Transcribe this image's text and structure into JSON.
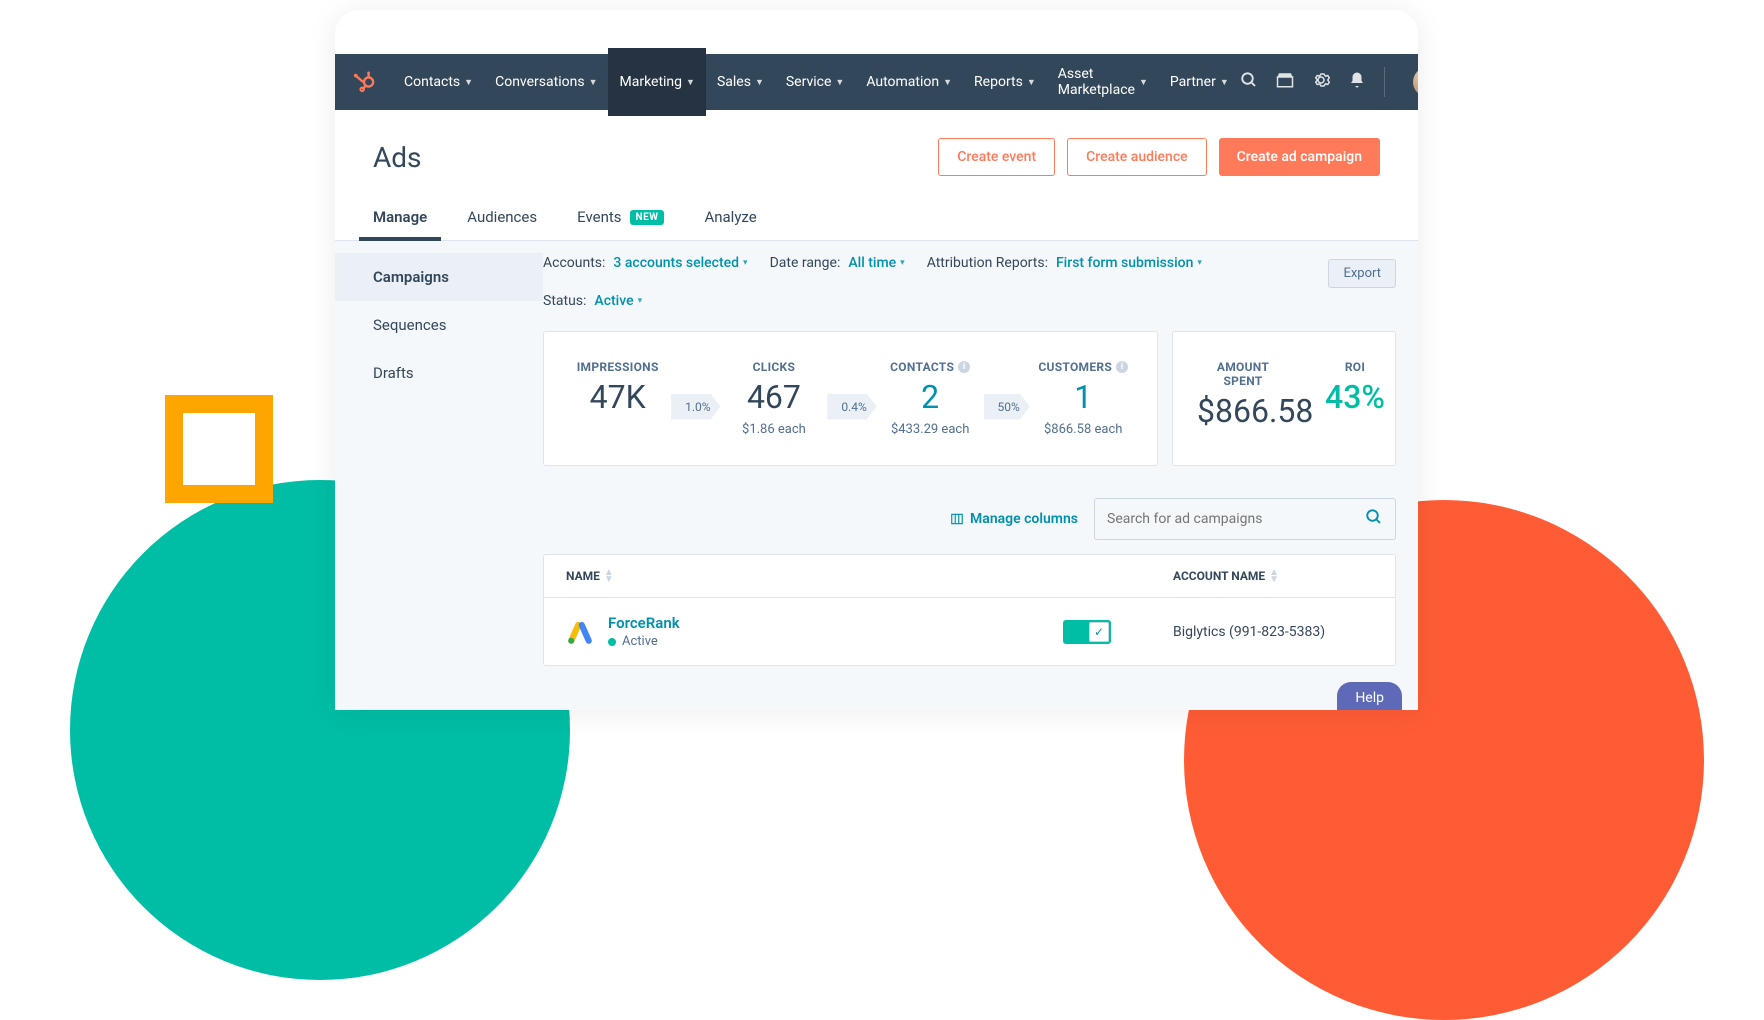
{
  "nav": {
    "items": [
      "Contacts",
      "Conversations",
      "Marketing",
      "Sales",
      "Service",
      "Automation",
      "Reports",
      "Asset Marketplace",
      "Partner"
    ],
    "activeIndex": 2
  },
  "page": {
    "title": "Ads",
    "actions": {
      "create_event": "Create event",
      "create_audience": "Create audience",
      "create_campaign": "Create ad campaign"
    }
  },
  "tabs": {
    "items": [
      {
        "label": "Manage"
      },
      {
        "label": "Audiences"
      },
      {
        "label": "Events",
        "badge": "NEW"
      },
      {
        "label": "Analyze"
      }
    ],
    "activeIndex": 0
  },
  "sidebar": {
    "items": [
      "Campaigns",
      "Sequences",
      "Drafts"
    ],
    "activeIndex": 0
  },
  "filters": {
    "accounts": {
      "label": "Accounts:",
      "value": "3 accounts selected"
    },
    "date_range": {
      "label": "Date range:",
      "value": "All time"
    },
    "attribution": {
      "label": "Attribution Reports:",
      "value": "First form submission"
    },
    "status": {
      "label": "Status:",
      "value": "Active"
    },
    "export": "Export"
  },
  "funnel": {
    "impressions": {
      "label": "IMPRESSIONS",
      "value": "47K"
    },
    "conv1": "1.0%",
    "clicks": {
      "label": "CLICKS",
      "value": "467",
      "sub": "$1.86 each"
    },
    "conv2": "0.4%",
    "contacts": {
      "label": "CONTACTS",
      "value": "2",
      "sub": "$433.29 each"
    },
    "conv3": "50%",
    "customers": {
      "label": "CUSTOMERS",
      "value": "1",
      "sub": "$866.58 each"
    }
  },
  "spend": {
    "amount": {
      "label": "AMOUNT SPENT",
      "value": "$866.58"
    },
    "roi": {
      "label": "ROI",
      "value": "43%"
    }
  },
  "table": {
    "manage_columns": "Manage columns",
    "search_placeholder": "Search for ad campaigns",
    "columns": {
      "name": "NAME",
      "account": "ACCOUNT NAME"
    },
    "rows": [
      {
        "name": "ForceRank",
        "status": "Active",
        "account": "Biglytics (991-823-5383)"
      }
    ]
  },
  "help": "Help"
}
